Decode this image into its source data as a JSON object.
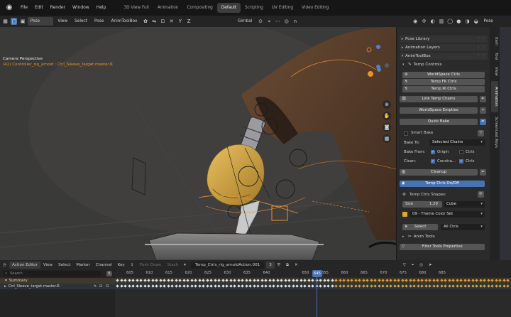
{
  "menubar": {
    "items": [
      "File",
      "Edit",
      "Render",
      "Window",
      "Help"
    ],
    "workspaces": [
      {
        "label": "3D View Full",
        "active": false
      },
      {
        "label": "Animation",
        "active": false
      },
      {
        "label": "Compositing",
        "active": false
      },
      {
        "label": "Default",
        "active": true
      },
      {
        "label": "Scripting",
        "active": false
      },
      {
        "label": "UV Editing",
        "active": false
      },
      {
        "label": "Video Editing",
        "active": false
      }
    ]
  },
  "header": {
    "mode": "Pose Mode",
    "menus": [
      "View",
      "Select",
      "Pose",
      "AnimToolBox"
    ],
    "transform_orientation": "Gimbal",
    "pose_options": "Pose Options"
  },
  "viewport": {
    "overlay_title": "Camera Perspective",
    "overlay_subtitle": "(42) Controller_rig_arnold : Ctrl_Sleeve_target.master.R"
  },
  "sidebar_tabs": [
    "Item",
    "Tool",
    "View",
    "Animation",
    "Screencast Keys"
  ],
  "npanel": {
    "pose_library": "Pose Library",
    "animation_layers": "Animation Layers",
    "animtoolbox": "AnimToolBox",
    "temp_controls": "Temp Controls",
    "worldspace_ctrls": "WorldSpace Ctrls",
    "temp_fk_ctrls": "Temp FK Ctrls",
    "temp_ik_ctrls": "Temp IK Ctrls",
    "link_temp_chains": "Link Temp Chains",
    "worldspace_empties": "WorldSpace Empties",
    "quick_bake": "Quick Bake",
    "smart_bake": "Smart Bake",
    "bake_to_label": "Bake To:",
    "bake_to_value": "Selected Chains",
    "bake_from_label": "Bake From:",
    "bake_from_origin": "Origin",
    "bake_from_ctrls": "Ctrls",
    "clean_label": "Clean:",
    "clean_constra": "Constra...",
    "clean_ctrls": "Ctrls",
    "cleanup": "Cleanup",
    "temp_ctrls_onoff": "Temp Ctrls On/Off",
    "temp_ctrls_shapes": "Temp Ctrls Shapes:",
    "size_label": "Size",
    "size_value": "1.29",
    "shape_value": "Cube",
    "color_set": "09 - Theme Color Set",
    "select": "Select",
    "all_ctrls": "All Ctrls",
    "anim_tools": "Anim Tools",
    "filter_tools_properties": "Filter Tools Properties"
  },
  "action_editor": {
    "editor_type": "Action Editor",
    "menus": [
      "View",
      "Select",
      "Marker",
      "Channel",
      "Key"
    ],
    "push_down": "Push Down",
    "stash": "Stash",
    "action_name": "Temp_Ctrls_rig_arnoldAction.001",
    "users": "3",
    "search_placeholder": "Search",
    "summary": "Summary",
    "channel": "Ctrl_Sleeve_target.master.R",
    "ticks": [
      "605",
      "610",
      "615",
      "620",
      "625",
      "630",
      "635",
      "640",
      "645",
      "650",
      "655",
      "660",
      "665",
      "670",
      "675",
      "680",
      "685"
    ],
    "current_frame": "645"
  },
  "colors": {
    "accent": "#4772b3",
    "orange": "#e8922e",
    "key_yellow": "#e5a42c"
  }
}
